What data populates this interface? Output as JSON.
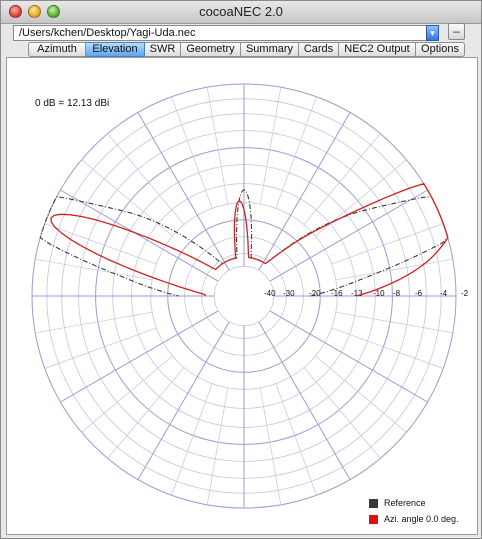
{
  "window": {
    "title": "cocoaNEC 2.0"
  },
  "path": {
    "value": "/Users/kchen/Desktop/Yagi-Uda.nec"
  },
  "buttons": {
    "minus_label": "–",
    "popup_icon": "popup-arrow-icon"
  },
  "tabs": [
    {
      "label": "Azimuth",
      "active": false
    },
    {
      "label": "Elevation",
      "active": true
    },
    {
      "label": "SWR",
      "active": false
    },
    {
      "label": "Geometry",
      "active": false
    },
    {
      "label": "Summary",
      "active": false
    },
    {
      "label": "Cards",
      "active": false
    },
    {
      "label": "NEC2 Output",
      "active": false
    },
    {
      "label": "Options",
      "active": false
    }
  ],
  "plot": {
    "scale_note": "0 dB = 12.13 dBi",
    "ring_labels": [
      "-40",
      "-30",
      "-20",
      "-16",
      "-13",
      "-10",
      "-8",
      "-6",
      "-4",
      "-2"
    ],
    "colors": {
      "grid_major": "#9b9bd6",
      "grid_minor": "#c4c4e6",
      "pattern": "#d62020",
      "reference": "#3a3a3a"
    }
  },
  "legend": [
    {
      "label": "Reference",
      "color": "#3a3a3a"
    },
    {
      "label": "Azi. angle  0.0 deg.",
      "color": "#e01010"
    }
  ]
}
